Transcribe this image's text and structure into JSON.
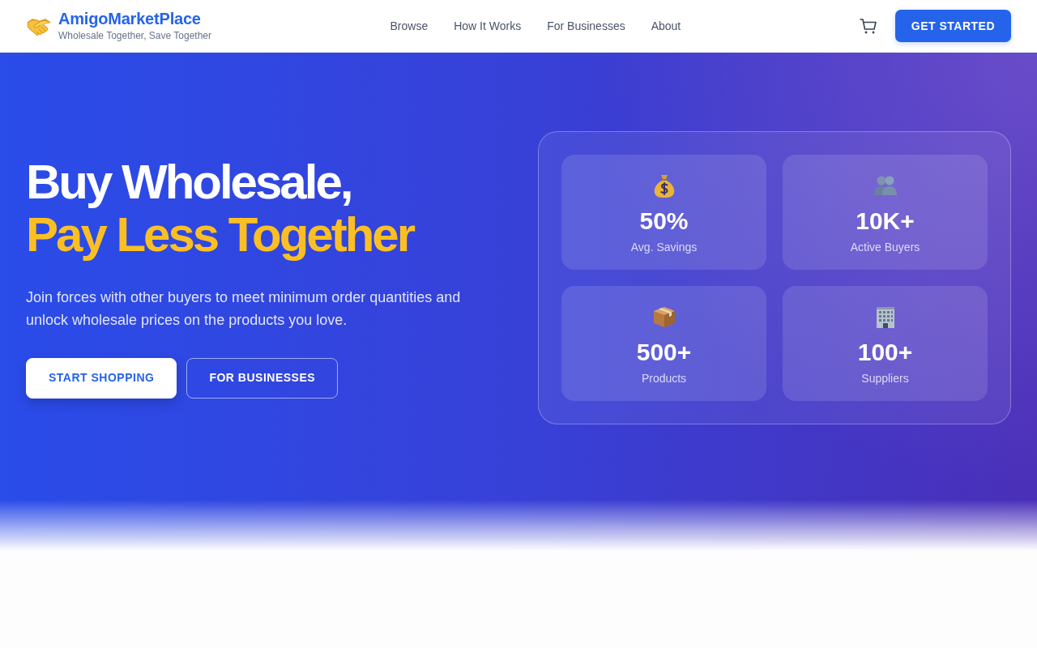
{
  "brand": {
    "name": "AmigoMarketPlace",
    "tagline": "Wholesale Together, Save Together"
  },
  "nav": {
    "links": [
      {
        "label": "Browse"
      },
      {
        "label": "How It Works"
      },
      {
        "label": "For Businesses"
      },
      {
        "label": "About"
      }
    ],
    "cta": "GET STARTED"
  },
  "hero": {
    "title_line_1": "Buy Wholesale,",
    "title_line_2": "Pay Less Together",
    "description": "Join forces with other buyers to meet minimum order quantities and unlock wholesale prices on the products you love.",
    "buttons": [
      {
        "label": "START SHOPPING",
        "kind": "solid"
      },
      {
        "label": "FOR BUSINESSES",
        "kind": "outline"
      }
    ]
  },
  "stats": [
    {
      "kind": "money",
      "value": "50%",
      "label": "Avg. Savings"
    },
    {
      "kind": "people",
      "value": "10K+",
      "label": "Active Buyers"
    },
    {
      "kind": "box",
      "value": "500+",
      "label": "Products"
    },
    {
      "kind": "building",
      "value": "100+",
      "label": "Suppliers"
    }
  ]
}
